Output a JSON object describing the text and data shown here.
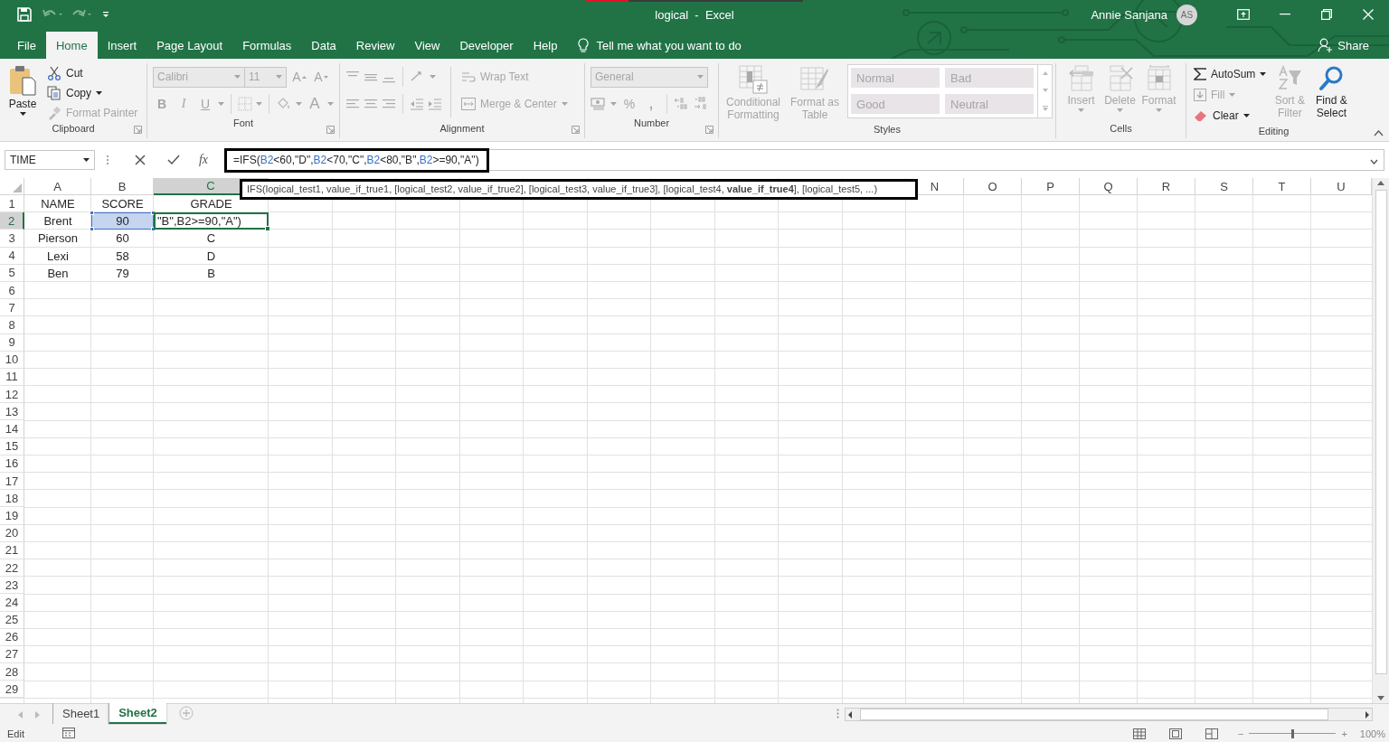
{
  "title_bar": {
    "title": "logical  -  Excel",
    "user": "Annie Sanjana",
    "avatar": "AS"
  },
  "tabs": [
    {
      "label": "File",
      "selected": false
    },
    {
      "label": "Home",
      "selected": true
    },
    {
      "label": "Insert",
      "selected": false
    },
    {
      "label": "Page Layout",
      "selected": false
    },
    {
      "label": "Formulas",
      "selected": false
    },
    {
      "label": "Data",
      "selected": false
    },
    {
      "label": "Review",
      "selected": false
    },
    {
      "label": "View",
      "selected": false
    },
    {
      "label": "Developer",
      "selected": false
    },
    {
      "label": "Help",
      "selected": false
    }
  ],
  "tell_me": {
    "placeholder": "Tell me what you want to do"
  },
  "share": "Share",
  "ribbon": {
    "clipboard": {
      "label": "Clipboard",
      "paste": {
        "label": "Paste",
        "disabled": false
      },
      "items": [
        {
          "kind": "cut",
          "label": "Cut",
          "disabled": false
        },
        {
          "kind": "copy",
          "label": "Copy",
          "disabled": false
        },
        {
          "kind": "format_painter",
          "label": "Format Painter",
          "disabled": true
        }
      ]
    },
    "font": {
      "label": "Font",
      "font_name": "Calibri",
      "font_size": "11",
      "grow": "A",
      "shrink": "A",
      "bold": "B",
      "italic": "I",
      "underline": "U",
      "font_color": "A",
      "disabled": true
    },
    "alignment": {
      "label": "Alignment",
      "wrap_text": "Wrap Text",
      "merge": "Merge & Center",
      "disabled": true
    },
    "number": {
      "label": "Number",
      "format": "General",
      "percent": "%",
      "comma": ",",
      "disabled": true
    },
    "styles": {
      "label": "Styles",
      "conditional": "Conditional\nFormatting",
      "format_table": "Format as\nTable",
      "gallery": [
        {
          "label": "Normal"
        },
        {
          "label": "Bad"
        },
        {
          "label": "Good"
        },
        {
          "label": "Neutral"
        }
      ],
      "disabled": true
    },
    "cells": {
      "label": "Cells",
      "items": [
        {
          "kind": "insert",
          "label": "Insert"
        },
        {
          "kind": "delete",
          "label": "Delete"
        },
        {
          "kind": "format",
          "label": "Format"
        }
      ],
      "disabled": true
    },
    "editing": {
      "label": "Editing",
      "items": [
        {
          "kind": "autosum",
          "label": "AutoSum",
          "disabled": false
        },
        {
          "kind": "fill",
          "label": "Fill",
          "disabled": true
        },
        {
          "kind": "clear",
          "label": "Clear",
          "disabled": false
        },
        {
          "kind": "sort",
          "label": "Sort &\nFilter",
          "disabled": true
        },
        {
          "kind": "find",
          "label": "Find &\nSelect",
          "disabled": false
        }
      ]
    }
  },
  "formula_bar": {
    "name_box": "TIME",
    "insert_function": "fx",
    "formula": [
      {
        "kind": "text",
        "text": "=IFS("
      },
      {
        "kind": "ref",
        "text": "B2"
      },
      {
        "kind": "text",
        "text": "<60,\"D\","
      },
      {
        "kind": "ref",
        "text": "B2"
      },
      {
        "kind": "text",
        "text": "<70,\"C\","
      },
      {
        "kind": "ref",
        "text": "B2"
      },
      {
        "kind": "text",
        "text": "<80,\"B\","
      },
      {
        "kind": "ref",
        "text": "B2"
      },
      {
        "kind": "text",
        "text": ">=90,\"A\")"
      }
    ]
  },
  "tooltip": "IFS(logical_test1, value_if_true1, [logical_test2, value_if_true2], [logical_test3, value_if_true3], [logical_test4, **value_if_true4**], [logical_test5, ...)",
  "columns": [
    {
      "label": "A",
      "selected": false
    },
    {
      "label": "B",
      "selected": false
    },
    {
      "label": "C",
      "selected": true
    },
    {
      "label": "N",
      "selected": false
    },
    {
      "label": "O",
      "selected": false
    },
    {
      "label": "P",
      "selected": false
    },
    {
      "label": "Q",
      "selected": false
    },
    {
      "label": "R",
      "selected": false
    },
    {
      "label": "S",
      "selected": false
    },
    {
      "label": "T",
      "selected": false
    },
    {
      "label": "U",
      "selected": false
    }
  ],
  "rows": [
    {
      "label": "1",
      "selected": false,
      "cells": [
        {
          "text": "NAME",
          "referenced": false,
          "active": false
        },
        {
          "text": "SCORE",
          "referenced": false,
          "active": false
        },
        {
          "text": "GRADE",
          "referenced": false,
          "active": false
        }
      ]
    },
    {
      "label": "2",
      "selected": true,
      "cells": [
        {
          "text": "Brent",
          "referenced": false,
          "active": false
        },
        {
          "text": "90",
          "referenced": true,
          "active": false
        },
        {
          "text": "\"B\",B2>=90,\"A\")",
          "referenced": false,
          "active": true
        }
      ]
    },
    {
      "label": "3",
      "selected": false,
      "cells": [
        {
          "text": "Pierson",
          "referenced": false,
          "active": false
        },
        {
          "text": "60",
          "referenced": false,
          "active": false
        },
        {
          "text": "C",
          "referenced": false,
          "active": false
        }
      ]
    },
    {
      "label": "4",
      "selected": false,
      "cells": [
        {
          "text": "Lexi",
          "referenced": false,
          "active": false
        },
        {
          "text": "58",
          "referenced": false,
          "active": false
        },
        {
          "text": "D",
          "referenced": false,
          "active": false
        }
      ]
    },
    {
      "label": "5",
      "selected": false,
      "cells": [
        {
          "text": "Ben",
          "referenced": false,
          "active": false
        },
        {
          "text": "79",
          "referenced": false,
          "active": false
        },
        {
          "text": "B",
          "referenced": false,
          "active": false
        }
      ]
    },
    {
      "label": "6",
      "selected": false
    },
    {
      "label": "7",
      "selected": false
    },
    {
      "label": "8",
      "selected": false
    },
    {
      "label": "9",
      "selected": false
    },
    {
      "label": "10",
      "selected": false
    },
    {
      "label": "11",
      "selected": false
    },
    {
      "label": "12",
      "selected": false
    },
    {
      "label": "13",
      "selected": false
    },
    {
      "label": "14",
      "selected": false
    },
    {
      "label": "15",
      "selected": false
    },
    {
      "label": "16",
      "selected": false
    },
    {
      "label": "17",
      "selected": false
    },
    {
      "label": "18",
      "selected": false
    },
    {
      "label": "19",
      "selected": false
    },
    {
      "label": "20",
      "selected": false
    },
    {
      "label": "21",
      "selected": false
    },
    {
      "label": "22",
      "selected": false
    },
    {
      "label": "23",
      "selected": false
    },
    {
      "label": "24",
      "selected": false
    },
    {
      "label": "25",
      "selected": false
    },
    {
      "label": "26",
      "selected": false
    },
    {
      "label": "27",
      "selected": false
    },
    {
      "label": "28",
      "selected": false
    },
    {
      "label": "29",
      "selected": false
    }
  ],
  "sheets": [
    {
      "label": "Sheet1",
      "selected": false
    },
    {
      "label": "Sheet2",
      "selected": true
    }
  ],
  "status": {
    "mode": "Edit",
    "zoom_out": "−",
    "zoom_in": "+",
    "zoom": {
      "level": 0.5,
      "label": "100%"
    }
  }
}
